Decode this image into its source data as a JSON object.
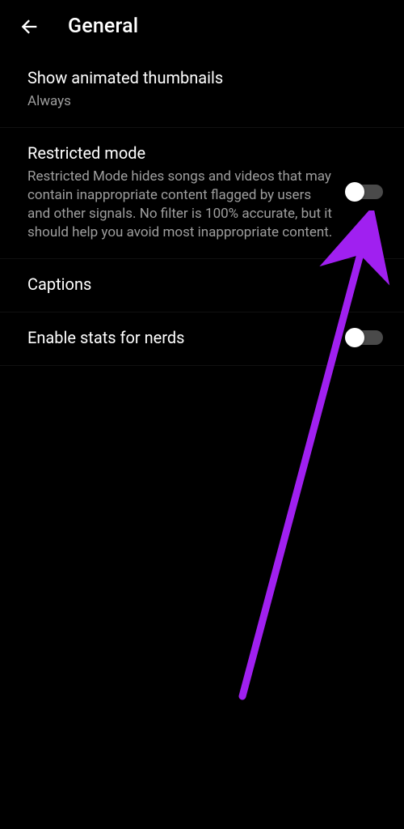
{
  "header": {
    "title": "General"
  },
  "settings": {
    "thumbnails": {
      "title": "Show animated thumbnails",
      "value": "Always"
    },
    "restricted": {
      "title": "Restricted mode",
      "desc": "Restricted Mode hides songs and videos that may contain inappropriate content flagged by users and other signals. No filter is 100% accurate, but it should help you avoid most inappropriate content."
    },
    "captions": {
      "title": "Captions"
    },
    "stats": {
      "title": "Enable stats for nerds"
    }
  },
  "annotation": {
    "color": "#a020f0"
  }
}
